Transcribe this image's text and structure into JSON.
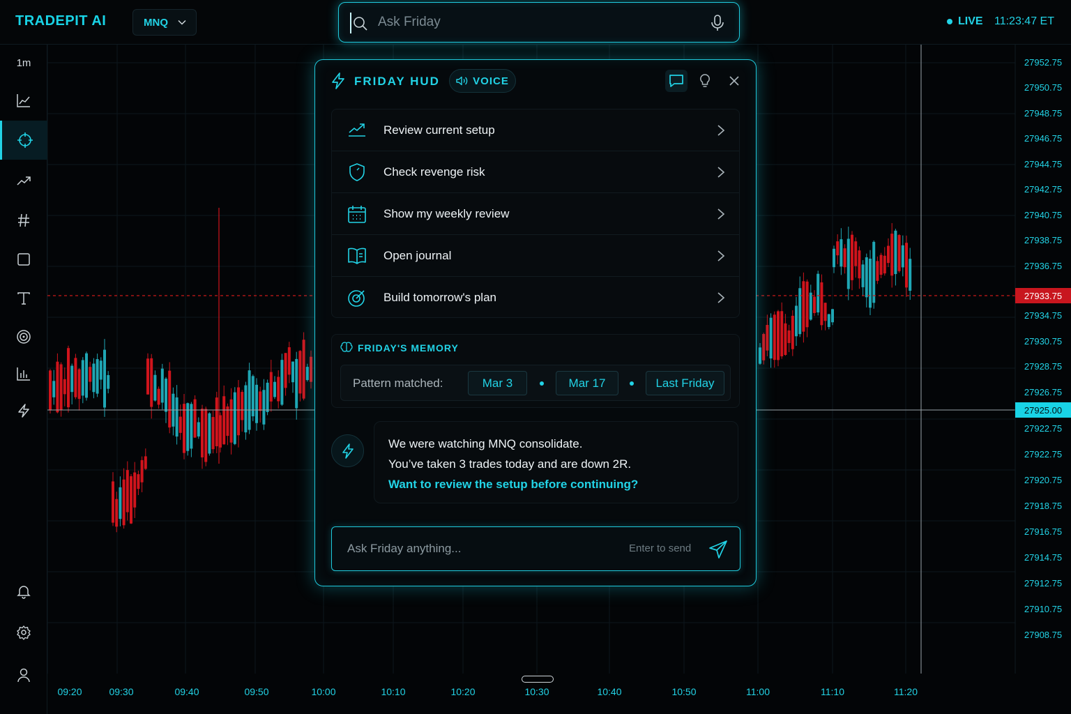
{
  "app": {
    "brand": "TRADEPIT AI"
  },
  "header": {
    "symbol": "MNQ",
    "search_placeholder": "Ask Friday",
    "live_label": "LIVE",
    "clock": "11:23:47 ET"
  },
  "sidebar": {
    "timeframe": "1m",
    "tools": [
      {
        "name": "line-chart-tool",
        "icon": "line-chart-icon"
      },
      {
        "name": "crosshair-tool",
        "icon": "crosshair-icon",
        "active": true
      },
      {
        "name": "trend-line-tool",
        "icon": "trend-line-icon"
      },
      {
        "name": "hash-tool",
        "icon": "hash-icon"
      },
      {
        "name": "rectangle-tool",
        "icon": "rectangle-icon"
      },
      {
        "name": "text-tool",
        "icon": "text-icon"
      },
      {
        "name": "target-tool",
        "icon": "target-icon"
      },
      {
        "name": "bar-chart-tool",
        "icon": "bar-chart-icon"
      },
      {
        "name": "lightning-tool",
        "icon": "lightning-icon"
      },
      {
        "name": "notifications-tool",
        "icon": "bell-icon"
      },
      {
        "name": "settings-tool",
        "icon": "gear-icon"
      },
      {
        "name": "profile-tool",
        "icon": "user-icon"
      }
    ]
  },
  "colors": {
    "accent": "#22d3e6",
    "bull": "#1fa6b4",
    "bear": "#d0141c",
    "alert_level": "#cc1a1a"
  },
  "price_axis": {
    "labels": [
      "27952.75",
      "27950.75",
      "27948.75",
      "27946.75",
      "27944.75",
      "27942.75",
      "27940.75",
      "27938.75",
      "27936.75",
      "27933.75",
      "27934.75",
      "27930.75",
      "27928.75",
      "27926.75",
      "27925.00",
      "27922.75",
      "27922.75",
      "27920.75",
      "27918.75",
      "27916.75",
      "27914.75",
      "27912.75",
      "27910.75",
      "27908.75"
    ],
    "alert_price": "27933.75",
    "current_price": "27925.00"
  },
  "time_axis": {
    "labels": [
      "09:20",
      "09:30",
      "09:40",
      "09:50",
      "10:00",
      "10:10",
      "10:20",
      "10:30",
      "10:40",
      "10:50",
      "11:00",
      "11:10",
      "11:20"
    ]
  },
  "hud": {
    "title": "FRIDAY HUD",
    "voice_label": "VOICE",
    "menu": [
      {
        "label": "Review current setup",
        "icon": "trending-up-icon"
      },
      {
        "label": "Check revenge risk",
        "icon": "shield-icon"
      },
      {
        "label": "Show my weekly review",
        "icon": "calendar-icon"
      },
      {
        "label": "Open journal",
        "icon": "book-icon"
      },
      {
        "label": "Build tomorrow's plan",
        "icon": "target-icon"
      }
    ],
    "memory": {
      "title": "FRIDAY'S MEMORY",
      "pattern_label": "Pattern matched:",
      "chips": [
        "Mar 3",
        "Mar 17",
        "Last Friday"
      ]
    },
    "message": {
      "line1": "We were watching MNQ consolidate.",
      "line2": "You’ve taken 3 trades today and are down 2R.",
      "cta": "Want to review the setup before continuing?"
    },
    "compose": {
      "placeholder": "Ask Friday anything...",
      "hint": "Enter to send"
    }
  }
}
